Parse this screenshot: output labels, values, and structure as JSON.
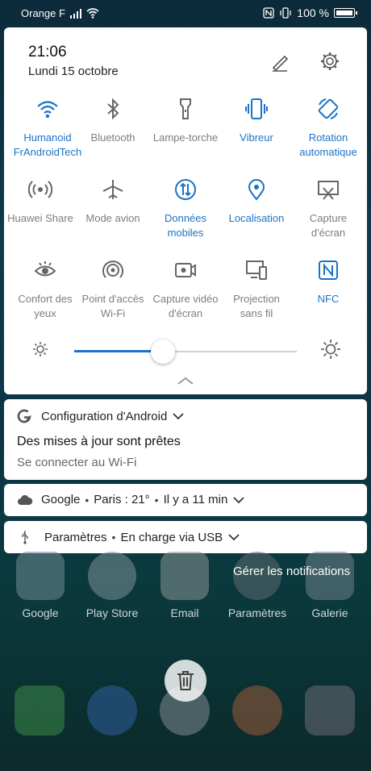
{
  "status_bar": {
    "carrier": "Orange F",
    "battery": "100 %"
  },
  "panel": {
    "time": "21:06",
    "date": "Lundi 15 octobre",
    "tiles": [
      {
        "label": "Humanoid\nFrAndroidTech",
        "icon": "wifi-icon",
        "active": true
      },
      {
        "label": "Bluetooth",
        "icon": "bluetooth-icon",
        "active": false
      },
      {
        "label": "Lampe-torche",
        "icon": "flashlight-icon",
        "active": false
      },
      {
        "label": "Vibreur",
        "icon": "vibrate-icon",
        "active": true
      },
      {
        "label": "Rotation\nautomatique",
        "icon": "rotation-icon",
        "active": true
      },
      {
        "label": "Huawei Share",
        "icon": "share-icon",
        "active": false
      },
      {
        "label": "Mode avion",
        "icon": "airplane-icon",
        "active": false
      },
      {
        "label": "Données\nmobiles",
        "icon": "mobile-data-icon",
        "active": true
      },
      {
        "label": "Localisation",
        "icon": "location-icon",
        "active": true
      },
      {
        "label": "Capture\nd'écran",
        "icon": "screenshot-icon",
        "active": false
      },
      {
        "label": "Confort des\nyeux",
        "icon": "eye-icon",
        "active": false
      },
      {
        "label": "Point d'accès\nWi-Fi",
        "icon": "hotspot-icon",
        "active": false
      },
      {
        "label": "Capture vidéo\nd'écran",
        "icon": "screen-record-icon",
        "active": false
      },
      {
        "label": "Projection\nsans fil",
        "icon": "cast-icon",
        "active": false
      },
      {
        "label": "NFC",
        "icon": "nfc-icon",
        "active": true
      }
    ],
    "brightness": 0.4
  },
  "notifications": {
    "android_app": "Configuration d'Android",
    "android_title": "Des mises à jour sont prêtes",
    "android_text": "Se connecter au Wi-Fi",
    "weather_app": "Google",
    "weather_text": "Paris : 21°",
    "weather_time": "Il y a 11 min",
    "usb_app": "Paramètres",
    "usb_text": "En charge via USB",
    "manage": "Gérer les notifications"
  },
  "home": {
    "apps": [
      "Google",
      "Play Store",
      "Email",
      "Paramètres",
      "Galerie"
    ]
  },
  "colors": {
    "accent": "#1a73c8",
    "inactive": "#7d7d7d"
  }
}
